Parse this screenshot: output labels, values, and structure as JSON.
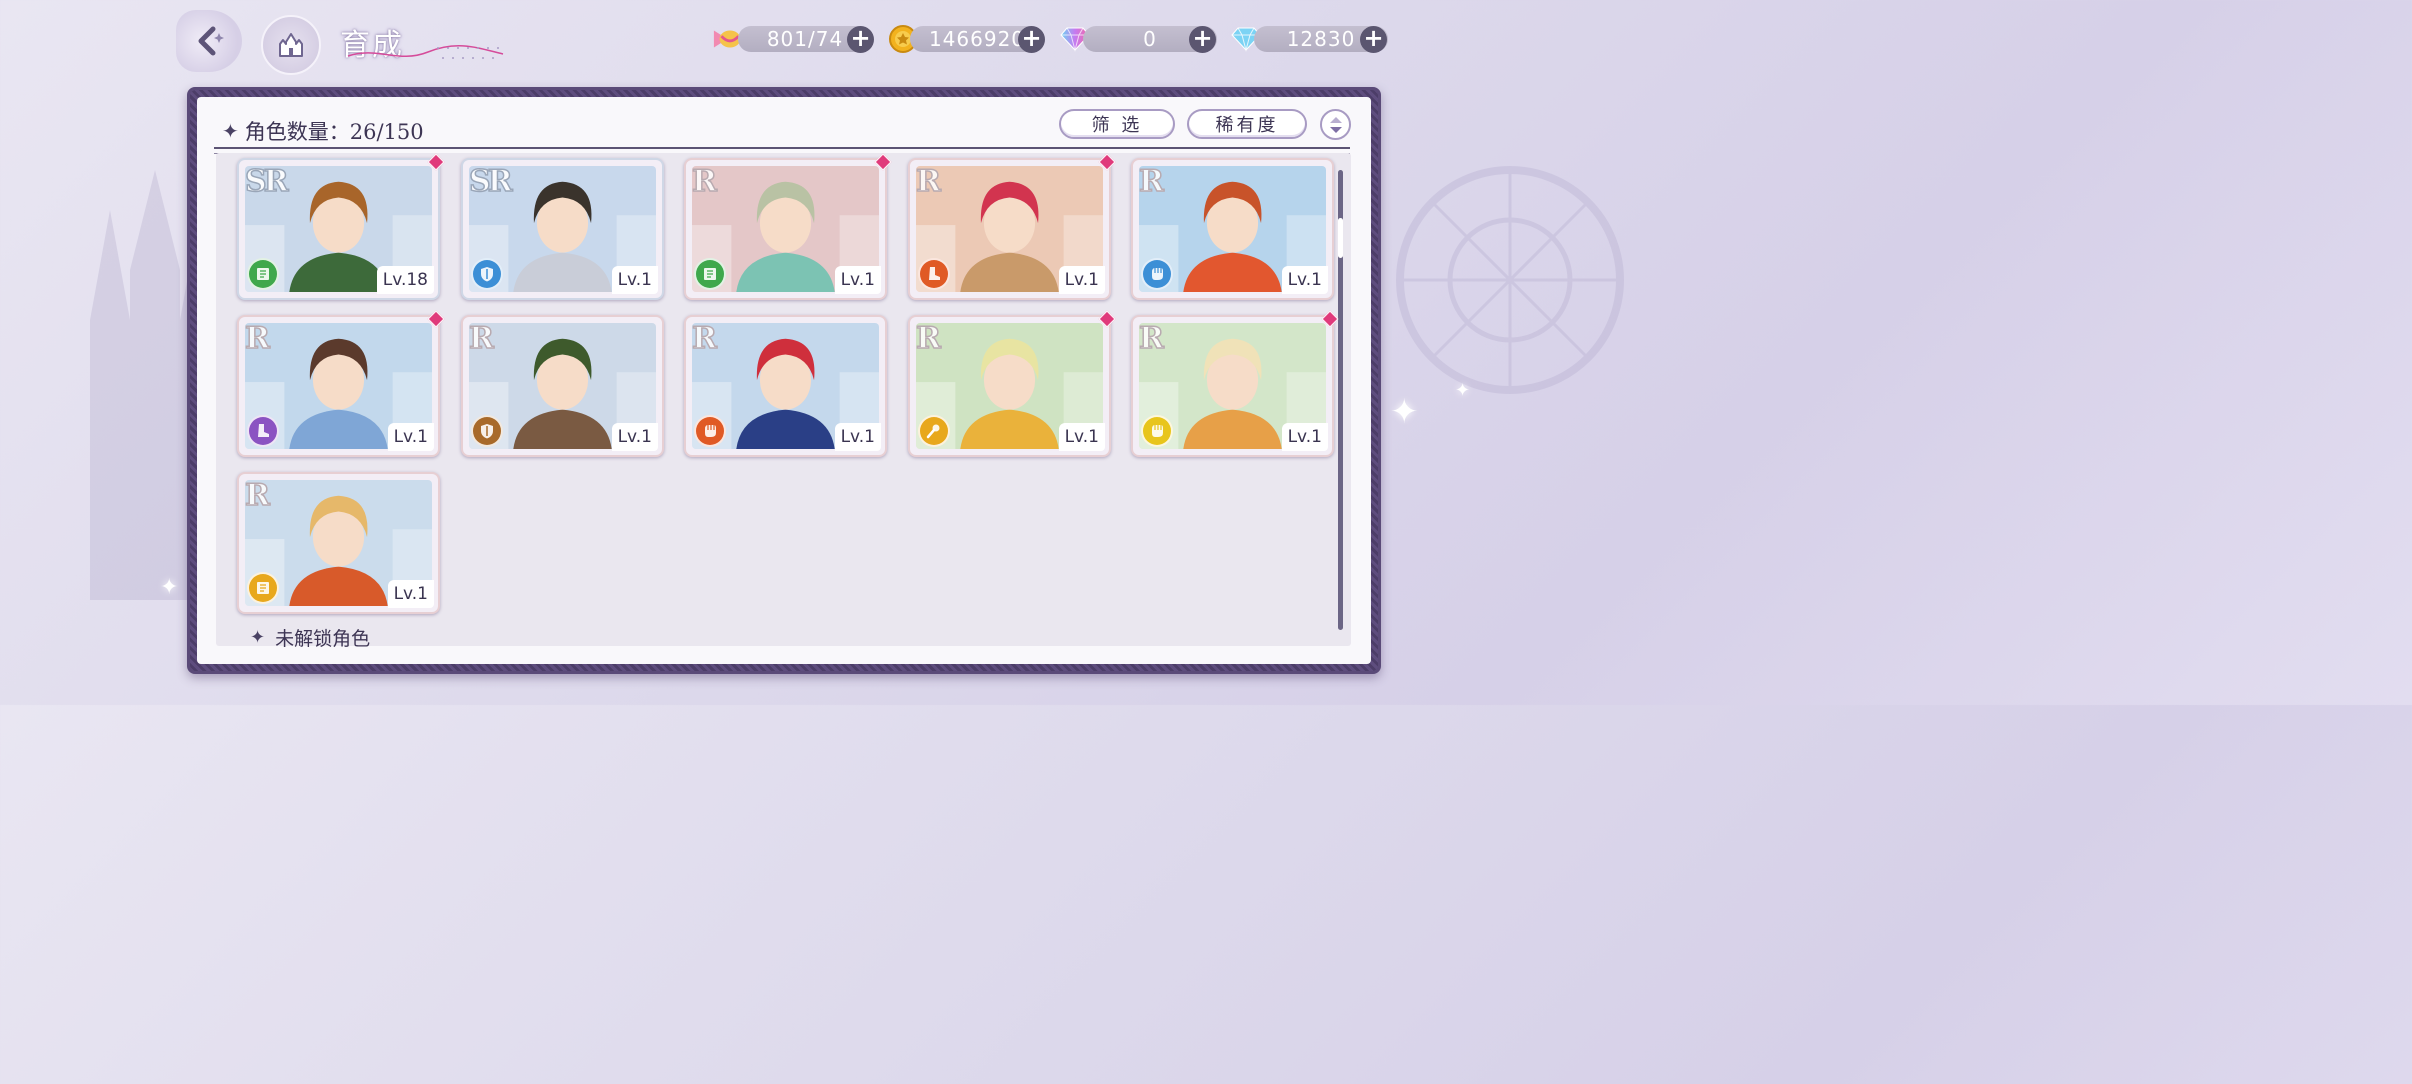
{
  "header": {
    "title": "育成",
    "resources": [
      {
        "icon": "candy-icon",
        "value": "801/74"
      },
      {
        "icon": "gold-coin-icon",
        "value": "1466920"
      },
      {
        "icon": "rainbow-gem-icon",
        "value": "0"
      },
      {
        "icon": "diamond-icon",
        "value": "12830"
      }
    ]
  },
  "panel": {
    "count_label": "角色数量：26/150",
    "filter_label": "筛 选",
    "sort_label": "稀有度",
    "locked_label": "未解锁角色"
  },
  "characters": [
    {
      "rarity": "SR",
      "level": "Lv.18",
      "attr_color": "#3fa84c",
      "attr_icon": "book-icon",
      "is_new": true,
      "bg": "#c9d8ea",
      "hair": "#a8652a",
      "outfit": "#3d6a3a"
    },
    {
      "rarity": "SR",
      "level": "Lv.1",
      "attr_color": "#3c8fd6",
      "attr_icon": "shield-icon",
      "is_new": false,
      "bg": "#c8d8ec",
      "hair": "#3a332c",
      "outfit": "#c9cdd8"
    },
    {
      "rarity": "R",
      "level": "Lv.1",
      "attr_color": "#3fa84c",
      "attr_icon": "book-icon",
      "is_new": true,
      "bg": "#e4c7c8",
      "hair": "#b9c2a4",
      "outfit": "#7cc3b3"
    },
    {
      "rarity": "R",
      "level": "Lv.1",
      "attr_color": "#e05a25",
      "attr_icon": "boot-icon",
      "is_new": true,
      "bg": "#ecc9b5",
      "hair": "#d2344f",
      "outfit": "#c99a6a"
    },
    {
      "rarity": "R",
      "level": "Lv.1",
      "attr_color": "#3c8fd6",
      "attr_icon": "fist-icon",
      "is_new": false,
      "bg": "#b6d4ec",
      "hair": "#c8532a",
      "outfit": "#e2572f"
    },
    {
      "rarity": "R",
      "level": "Lv.1",
      "attr_color": "#8b53c2",
      "attr_icon": "boot-icon",
      "is_new": true,
      "bg": "#c2d8ec",
      "hair": "#5b3a2c",
      "outfit": "#7fa6d6"
    },
    {
      "rarity": "R",
      "level": "Lv.1",
      "attr_color": "#a86a2a",
      "attr_icon": "shield-icon",
      "is_new": false,
      "bg": "#cdd9e8",
      "hair": "#3e5a2c",
      "outfit": "#7a5a42"
    },
    {
      "rarity": "R",
      "level": "Lv.1",
      "attr_color": "#e05a25",
      "attr_icon": "fist-icon",
      "is_new": false,
      "bg": "#c4d8ec",
      "hair": "#cf2f3c",
      "outfit": "#2a3f86"
    },
    {
      "rarity": "R",
      "level": "Lv.1",
      "attr_color": "#e8a81c",
      "attr_icon": "staff-icon",
      "is_new": true,
      "bg": "#cfe3c2",
      "hair": "#e8e4a2",
      "outfit": "#eab23b"
    },
    {
      "rarity": "R",
      "level": "Lv.1",
      "attr_color": "#e8c51c",
      "attr_icon": "fist-icon",
      "is_new": true,
      "bg": "#d3e6c9",
      "hair": "#f0e2b8",
      "outfit": "#e7a048"
    },
    {
      "rarity": "R",
      "level": "Lv.1",
      "attr_color": "#e8a81c",
      "attr_icon": "book-icon",
      "is_new": false,
      "bg": "#cbdcec",
      "hair": "#e6b86a",
      "outfit": "#d85a2a"
    }
  ]
}
